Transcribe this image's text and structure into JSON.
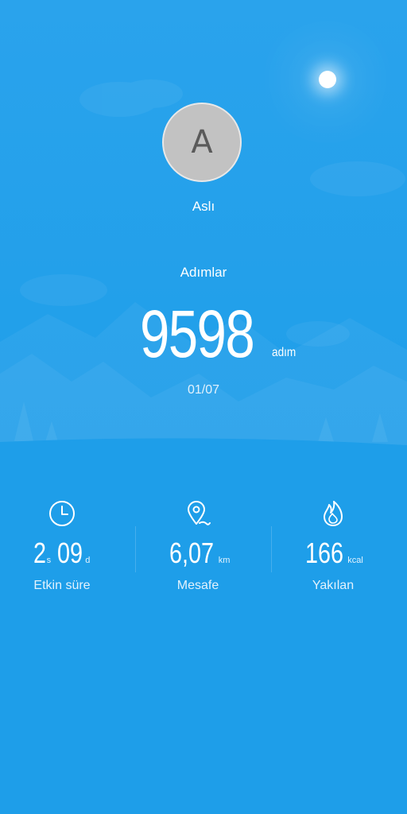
{
  "profile": {
    "avatar_initial": "A",
    "name": "Aslı"
  },
  "steps": {
    "label": "Adımlar",
    "value": "9598",
    "unit": "adım",
    "date": "01/07"
  },
  "stats": {
    "active_time": {
      "icon": "clock-icon",
      "hours": "2",
      "hours_unit": "s",
      "minutes": "09",
      "minutes_unit": "d",
      "label": "Etkin süre"
    },
    "distance": {
      "icon": "location-pin-icon",
      "value": "6,07",
      "unit": "km",
      "label": "Mesafe"
    },
    "calories": {
      "icon": "flame-icon",
      "value": "166",
      "unit": "kcal",
      "label": "Yakılan"
    }
  },
  "colors": {
    "background": "#1e9ee9",
    "text": "#ffffff"
  }
}
